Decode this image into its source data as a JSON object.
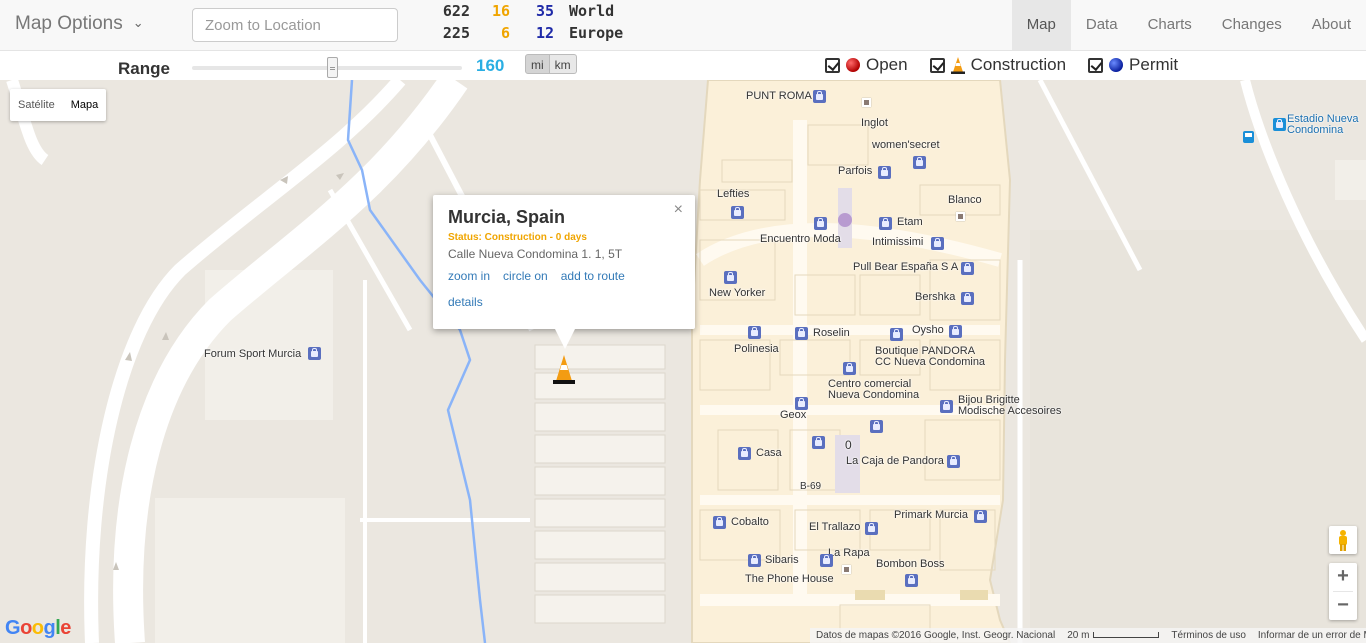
{
  "header": {
    "map_options_label": "Map Options",
    "zoom_placeholder": "Zoom to Location",
    "stats": [
      {
        "total": "622",
        "construction": "16",
        "permit": "35",
        "region": "World"
      },
      {
        "total": "225",
        "construction": "6",
        "permit": "12",
        "region": "Europe"
      }
    ],
    "nav": [
      "Map",
      "Data",
      "Charts",
      "Changes",
      "About"
    ],
    "active_nav": "Map"
  },
  "range": {
    "label": "Range",
    "value": "160",
    "slider_fraction": 0.52,
    "units": [
      "mi",
      "km"
    ],
    "selected_unit": "mi"
  },
  "filters": [
    {
      "label": "Open",
      "checked": true,
      "icon": "red-dot-icon"
    },
    {
      "label": "Construction",
      "checked": true,
      "icon": "traffic-cone-icon"
    },
    {
      "label": "Permit",
      "checked": true,
      "icon": "blue-dot-icon"
    }
  ],
  "map": {
    "type_buttons": [
      "Satélite",
      "Mapa"
    ],
    "active_type": "Mapa",
    "labels": {
      "forum": "Forum Sport Murcia",
      "estadio_1": "Estadio Nueva",
      "estadio_2": "Condomina",
      "punt_roma": "PUNT ROMA",
      "inglot": "Inglot",
      "womens": "women'secret",
      "parfois": "Parfois",
      "lefties": "Lefties",
      "blanco": "Blanco",
      "etam": "Etam",
      "encuentro": "Encuentro Moda",
      "intimissimi": "Intimissimi",
      "pullbear": "Pull Bear España S A",
      "newyorker": "New Yorker",
      "bershka": "Bershka",
      "roselin": "Roselin",
      "oysho": "Oysho",
      "polinesia": "Polinesia",
      "pandora_1": "Boutique PANDORA",
      "pandora_2": "CC Nueva Condomina",
      "centro_1": "Centro comercial",
      "centro_2": "Nueva Condomina",
      "bijou_1": "Bijou Brigitte",
      "bijou_2": "Modische Accesoires",
      "geox": "Geox",
      "zero": "0",
      "casa": "Casa",
      "caja": "La Caja de Pandora",
      "b69": "B-69",
      "cobalto": "Cobalto",
      "primark": "Primark Murcia",
      "trallazo": "El Trallazo",
      "larapa": "La Rapa",
      "sibaris": "Sibaris",
      "phonehouse": "The Phone House",
      "bombon": "Bombon Boss"
    },
    "popup": {
      "title": "Murcia, Spain",
      "status": "Status: Construction - 0 days",
      "address": "Calle Nueva Condomina 1. 1, 5T",
      "links": [
        "zoom in",
        "circle on",
        "add to route"
      ],
      "details": "details",
      "close": "×"
    },
    "zoom_in": "+",
    "zoom_out": "−",
    "google_logo": [
      "G",
      "o",
      "o",
      "g",
      "l",
      "e"
    ],
    "attribution": {
      "data": "Datos de mapas ©2016 Google, Inst. Geogr. Nacional",
      "scale": "20 m",
      "terms": "Términos de uso",
      "report": "Informar de un error de Maps"
    }
  },
  "colors": {
    "accent_range": "#29aee3",
    "construction": "#f0a500",
    "permit": "#1f2aa8",
    "link": "#337ab7",
    "mall_fill": "#fbf0d9",
    "map_bg": "#ebe7e0",
    "water": "#8ab4f8"
  }
}
